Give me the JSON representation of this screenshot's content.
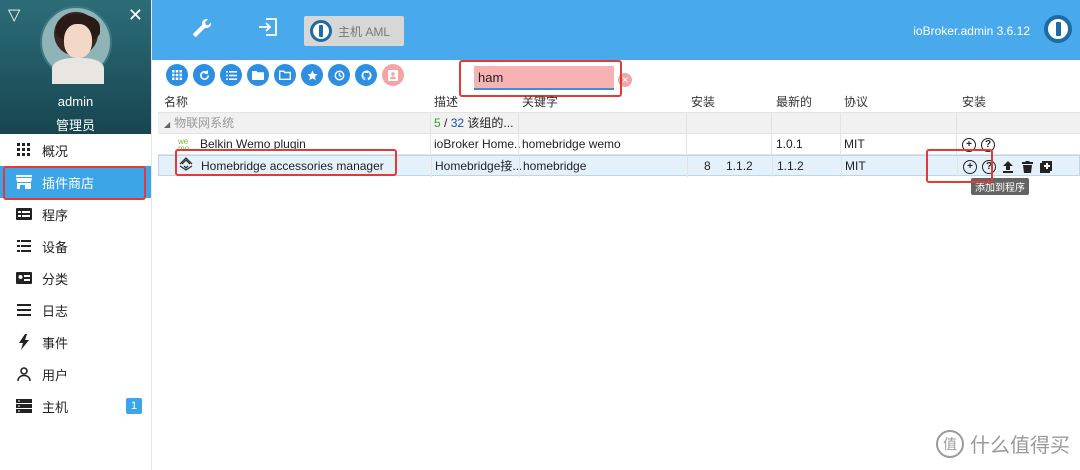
{
  "sidebar": {
    "user_name": "admin",
    "user_role": "管理员",
    "items": [
      {
        "label": "概况",
        "icon": "grid-icon"
      },
      {
        "label": "插件商店",
        "icon": "store-icon"
      },
      {
        "label": "程序",
        "icon": "instances-icon"
      },
      {
        "label": "设备",
        "icon": "list-icon"
      },
      {
        "label": "分类",
        "icon": "enums-icon"
      },
      {
        "label": "日志",
        "icon": "log-icon"
      },
      {
        "label": "事件",
        "icon": "flash-icon"
      },
      {
        "label": "用户",
        "icon": "user-icon"
      },
      {
        "label": "主机",
        "icon": "hosts-icon",
        "badge": "1"
      }
    ],
    "active_index": 1
  },
  "header": {
    "host_label": "主机 AML",
    "version": "ioBroker.admin 3.6.12"
  },
  "toolbar": {
    "search_value": "ham"
  },
  "table": {
    "headers": [
      "名称",
      "描述",
      "关键字",
      "安装",
      "最新的",
      "协议",
      "安装"
    ],
    "group": {
      "name": "物联网系统",
      "count_installed": "5",
      "count_sep": "/",
      "count_total": "32",
      "count_suffix": "该组的..."
    },
    "rows": [
      {
        "name": "Belkin Wemo plugin",
        "desc": "ioBroker Home...",
        "keywords": "homebridge wemo",
        "installed": "",
        "installed_version": "",
        "latest": "1.0.1",
        "license": "MIT",
        "logo": "wemo-logo-icon",
        "selected": false
      },
      {
        "name": "Homebridge accessories manager",
        "desc": "Homebridge接...",
        "keywords": "homebridge",
        "installed": "8",
        "installed_version": "1.1.2",
        "latest": "1.1.2",
        "license": "MIT",
        "logo": "homebridge-icon",
        "selected": true
      }
    ],
    "tooltip": "添加到程序"
  },
  "watermark": {
    "text": "什么值得买"
  },
  "colors": {
    "header_bg": "#48aaec",
    "active_nav": "#3ca5e8",
    "toolbar_btn": "#2d8fe2",
    "annotation_red": "#e53935"
  }
}
